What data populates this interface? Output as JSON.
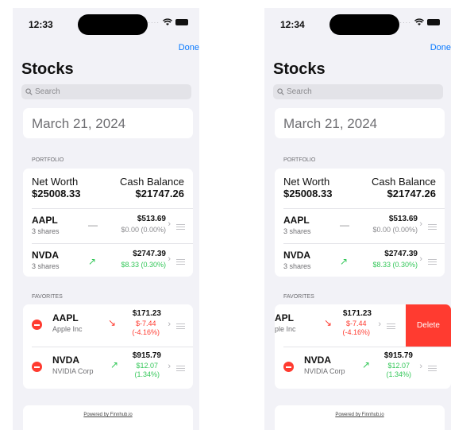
{
  "left": {
    "time": "12:33",
    "done": "Done",
    "title": "Stocks",
    "search_placeholder": "Search",
    "date": "March 21, 2024",
    "portfolio_label": "PORTFOLIO",
    "net_worth_label": "Net Worth",
    "net_worth": "$25008.33",
    "cash_label": "Cash Balance",
    "cash": "$21747.26",
    "holdings": [
      {
        "ticker": "AAPL",
        "shares": "3 shares",
        "price": "$513.69",
        "change": "$0.00 (0.00%)",
        "trend": "—"
      },
      {
        "ticker": "NVDA",
        "shares": "3 shares",
        "price": "$2747.39",
        "change": "$8.33 (0.30%)",
        "trend": "↗"
      }
    ],
    "favorites_label": "FAVORITES",
    "favorites": [
      {
        "ticker": "AAPL",
        "name": "Apple Inc",
        "price": "$171.23",
        "change1": "$-7.44",
        "change2": "(-4.16%)",
        "trend": "↘"
      },
      {
        "ticker": "NVDA",
        "name": "NVIDIA Corp",
        "price": "$915.79",
        "change1": "$12.07",
        "change2": "(1.34%)",
        "trend": "↗"
      }
    ],
    "footer": "Powered by Finnhub.io"
  },
  "right": {
    "time": "12:34",
    "done": "Done",
    "title": "Stocks",
    "search_placeholder": "Search",
    "date": "March 21, 2024",
    "portfolio_label": "PORTFOLIO",
    "net_worth_label": "Net Worth",
    "net_worth": "$25008.33",
    "cash_label": "Cash Balance",
    "cash": "$21747.26",
    "holdings": [
      {
        "ticker": "AAPL",
        "shares": "3 shares",
        "price": "$513.69",
        "change": "$0.00 (0.00%)",
        "trend": "—"
      },
      {
        "ticker": "NVDA",
        "shares": "3 shares",
        "price": "$2747.39",
        "change": "$8.33 (0.30%)",
        "trend": "↗"
      }
    ],
    "favorites_label": "FAVORITES",
    "favorites": [
      {
        "ticker": "APL",
        "name": "ple Inc",
        "price": "$171.23",
        "change1": "$-7.44",
        "change2": "(-4.16%)",
        "trend": "↘"
      },
      {
        "ticker": "NVDA",
        "name": "NVIDIA Corp",
        "price": "$915.79",
        "change1": "$12.07",
        "change2": "(1.34%)",
        "trend": "↗"
      }
    ],
    "delete_label": "Delete",
    "footer": "Powered by Finnhub.io"
  },
  "colors": {
    "accent": "#0a7aff",
    "up": "#34c759",
    "down": "#ff3b30",
    "background": "#f2f2f7"
  }
}
